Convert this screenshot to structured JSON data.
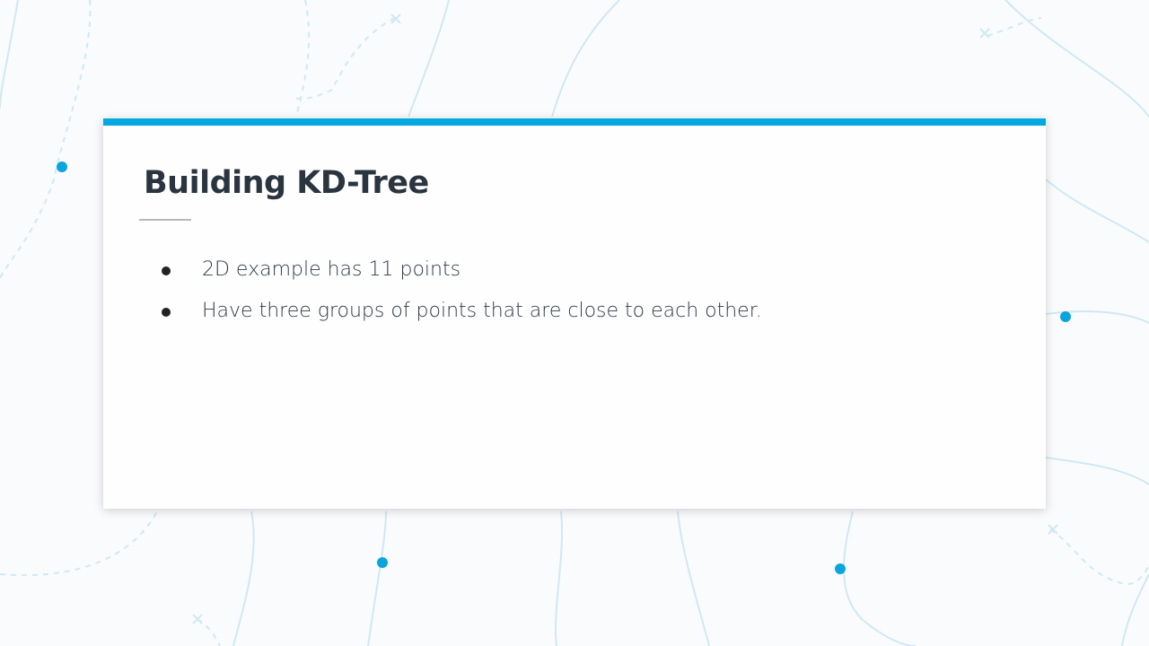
{
  "slide": {
    "title": "Building KD-Tree",
    "bullets": [
      "2D example has 11 points",
      "Have three groups of points that are close to each other."
    ]
  },
  "colors": {
    "accent": "#02a9e0",
    "background_lines": "#cde9f4",
    "text": "#2a3540"
  }
}
